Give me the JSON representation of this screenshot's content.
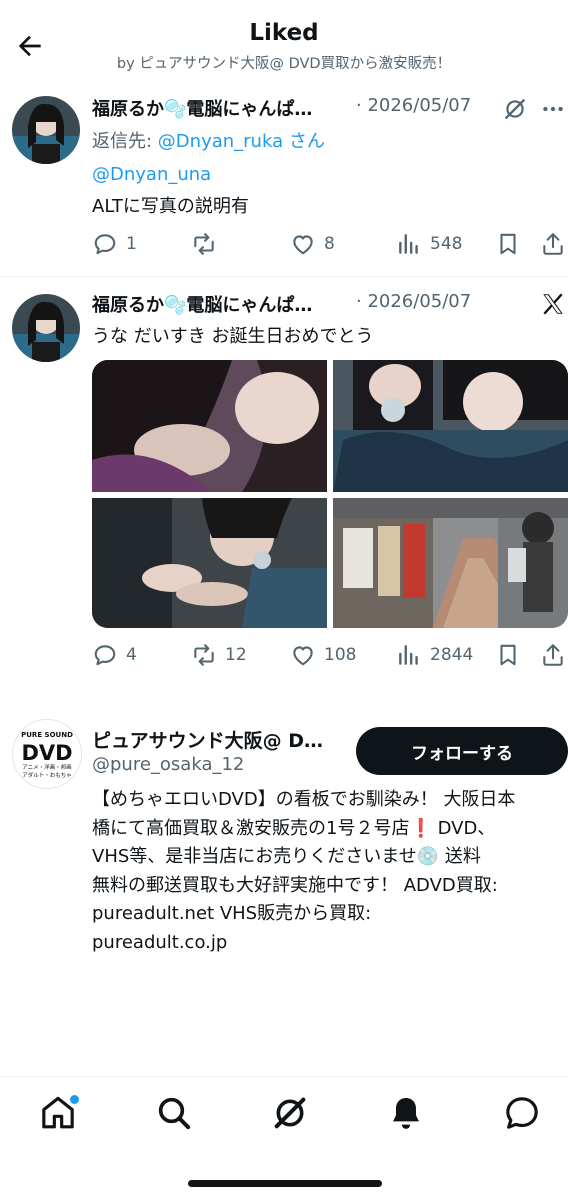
{
  "header": {
    "title": "Liked",
    "subtitle": "by ピュアサウンド大阪@ DVD買取から激安販売！"
  },
  "posts": [
    {
      "author": "福原るか🫧電脳にゃんぱ…",
      "date": "· 2026/05/07",
      "reply_prefix": "返信先: ",
      "reply_to": "@Dnyan_ruka",
      "reply_suffix": " さん",
      "mention": "@Dnyan_una",
      "text": "ALTに写真の説明有",
      "replies": "1",
      "reposts": "",
      "likes": "8",
      "views": "548"
    },
    {
      "author": "福原るか🫧電脳にゃんぱ…",
      "date": "· 2026/05/07",
      "text": "うな だいすき お誕生日おめでとう",
      "replies": "4",
      "reposts": "12",
      "likes": "108",
      "views": "2844"
    }
  ],
  "profile": {
    "name": "ピュアサウンド大阪@ D…",
    "handle": "@pure_osaka_12",
    "follow_label": "フォローする",
    "logo_top": "PURE SOUND",
    "logo_main": "DVD",
    "logo_line1": "アニメ・洋画・邦画",
    "logo_line2": "アダルト・おもちゃ",
    "bio_lines": [
      "【めちゃエロいDVD】の看板でお馴染み！ 大阪日本",
      "橋にて高価買取＆激安販売の1号２号店❗️ DVD、",
      "VHS等、是非当店にお売りくださいませ💿 送料",
      "無料の郵送買取も大好評実施中です！ ADVD買取:",
      "pureadult.net VHS販売から買取:",
      "pureadult.co.jp"
    ]
  },
  "colors": {
    "accent": "#1d9bf0",
    "text": "#0f1419",
    "muted": "#536471"
  },
  "tabbar": {
    "items": [
      "home-icon",
      "search-icon",
      "grok-icon",
      "notifications-icon",
      "messages-icon"
    ]
  }
}
